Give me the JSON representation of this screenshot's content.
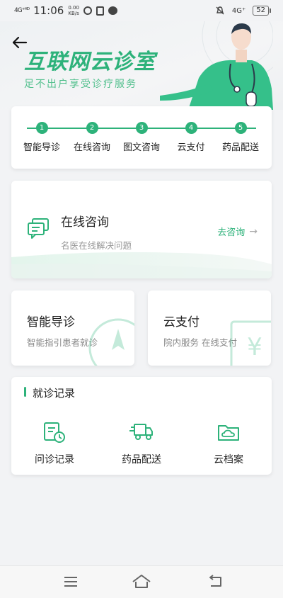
{
  "status_bar": {
    "signal": "4G⁺ᴴᴰ",
    "time": "11:06",
    "net_speed_value": "0.00",
    "net_speed_unit": "KB/s",
    "net_right": "4G⁺",
    "battery": "52"
  },
  "header": {
    "title": "互联网云诊室",
    "subtitle": "足不出户享受诊疗服务"
  },
  "steps": [
    {
      "num": "1",
      "label": "智能导诊"
    },
    {
      "num": "2",
      "label": "在线咨询"
    },
    {
      "num": "3",
      "label": "图文咨询"
    },
    {
      "num": "4",
      "label": "云支付"
    },
    {
      "num": "5",
      "label": "药品配送"
    }
  ],
  "consult": {
    "title": "在线咨询",
    "subtitle": "名医在线解决问题",
    "action": "去咨询"
  },
  "guide": {
    "title": "智能导诊",
    "subtitle": "智能指引患者就诊"
  },
  "pay": {
    "title": "云支付",
    "subtitle": "院内服务  在线支付"
  },
  "records": {
    "title": "就诊记录",
    "items": [
      {
        "label": "问诊记录",
        "icon": "clipboard-clock-icon"
      },
      {
        "label": "药品配送",
        "icon": "delivery-truck-icon"
      },
      {
        "label": "云档案",
        "icon": "cloud-folder-icon"
      }
    ]
  },
  "colors": {
    "accent": "#2db27a",
    "background": "#f2f3f5"
  }
}
